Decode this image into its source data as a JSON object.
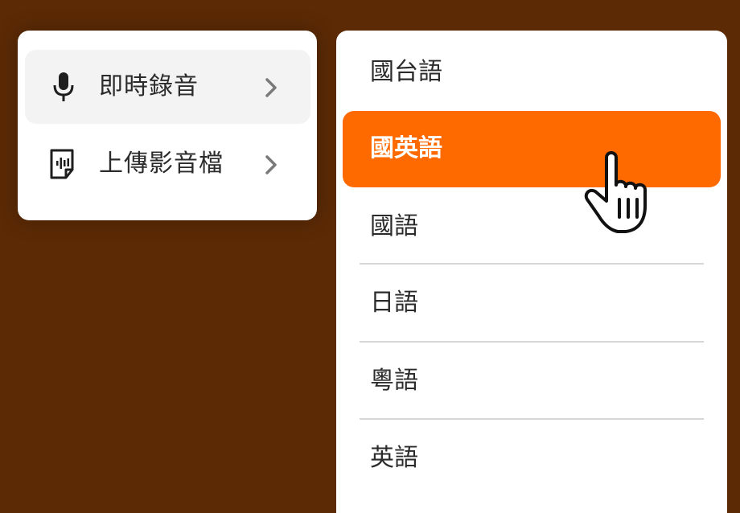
{
  "left_menu": {
    "items": [
      {
        "label": "即時錄音",
        "icon": "microphone-icon",
        "active": true
      },
      {
        "label": "上傳影音檔",
        "icon": "audio-file-icon",
        "active": false
      }
    ]
  },
  "language_menu": {
    "items": [
      {
        "label": "國台語"
      },
      {
        "label": "國英語",
        "selected": true
      },
      {
        "label": "國語"
      },
      {
        "label": "日語"
      },
      {
        "label": "粵語"
      },
      {
        "label": "英語"
      }
    ]
  },
  "colors": {
    "background": "#5c2a05",
    "accent": "#ff6a00",
    "panel": "#ffffff",
    "hover": "#f3f3f3"
  }
}
